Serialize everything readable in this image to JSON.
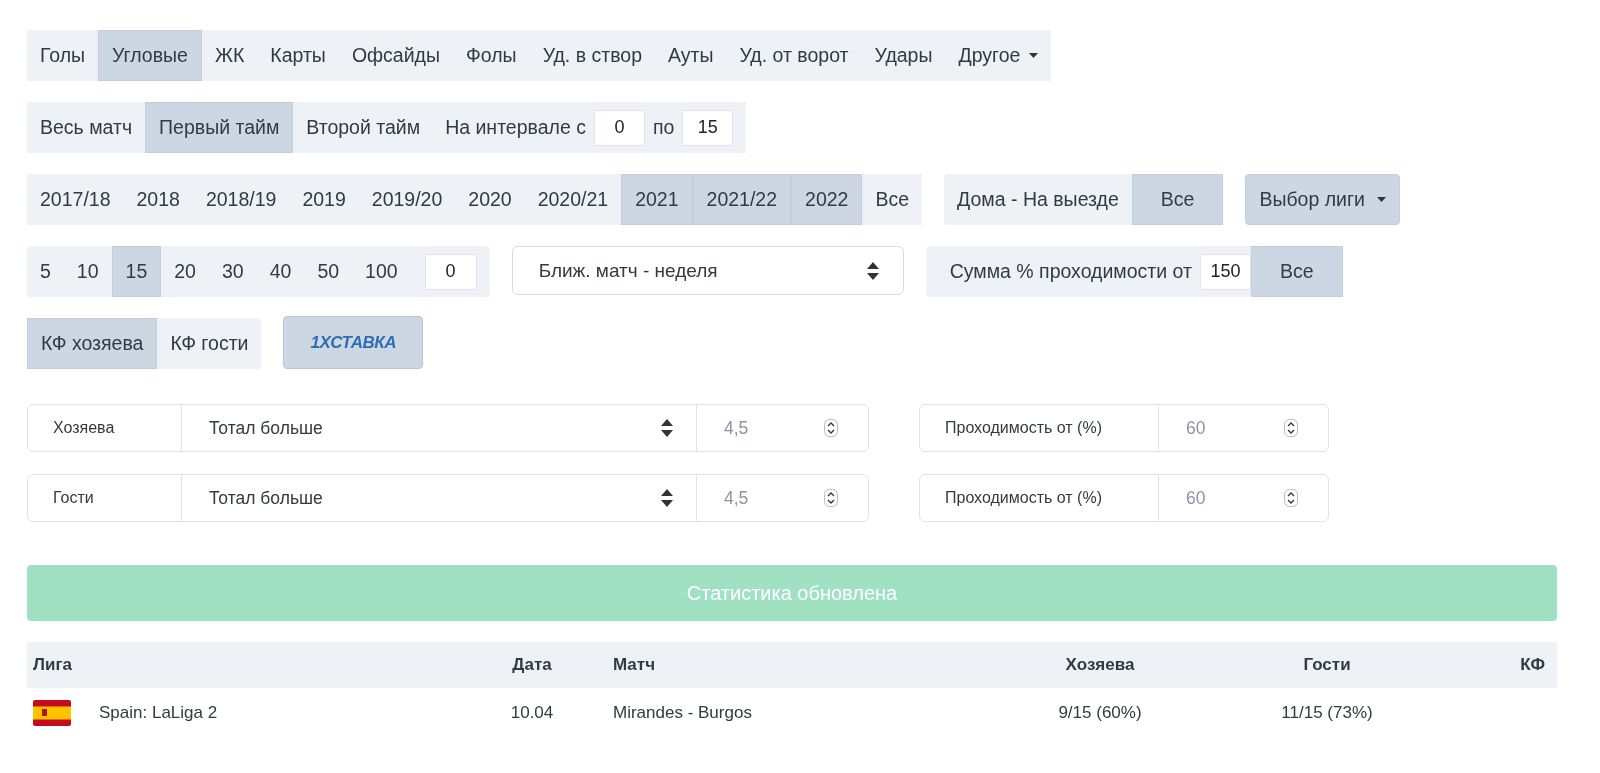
{
  "stat_tabs": [
    {
      "label": "Голы",
      "selected": false
    },
    {
      "label": "Угловые",
      "selected": true
    },
    {
      "label": "ЖК",
      "selected": false
    },
    {
      "label": "Карты",
      "selected": false
    },
    {
      "label": "Офсайды",
      "selected": false
    },
    {
      "label": "Фолы",
      "selected": false
    },
    {
      "label": "Уд. в створ",
      "selected": false
    },
    {
      "label": "Ауты",
      "selected": false
    },
    {
      "label": "Уд. от ворот",
      "selected": false
    },
    {
      "label": "Удары",
      "selected": false
    },
    {
      "label": "Другое",
      "selected": false,
      "kind": "dropdown"
    }
  ],
  "period": {
    "tabs": [
      {
        "label": "Весь матч",
        "selected": false
      },
      {
        "label": "Первый тайм",
        "selected": true
      },
      {
        "label": "Второй тайм",
        "selected": false
      }
    ],
    "interval_label": "На интервале с",
    "from": "0",
    "to_label": "по",
    "to": "15"
  },
  "seasons": [
    {
      "label": "2017/18",
      "selected": false
    },
    {
      "label": "2018",
      "selected": false
    },
    {
      "label": "2018/19",
      "selected": false
    },
    {
      "label": "2019",
      "selected": false
    },
    {
      "label": "2019/20",
      "selected": false
    },
    {
      "label": "2020",
      "selected": false
    },
    {
      "label": "2020/21",
      "selected": false
    },
    {
      "label": "2021",
      "selected": true
    },
    {
      "label": "2021/22",
      "selected": true
    },
    {
      "label": "2022",
      "selected": true
    },
    {
      "label": "Все",
      "selected": false
    }
  ],
  "venue": [
    {
      "label": "Дома - На выезде",
      "selected": false
    },
    {
      "label": "Все",
      "selected": true
    }
  ],
  "league_button": {
    "label": "Выбор лиги"
  },
  "match_counts": {
    "items": [
      {
        "label": "5",
        "selected": false
      },
      {
        "label": "10",
        "selected": false
      },
      {
        "label": "15",
        "selected": true
      },
      {
        "label": "20",
        "selected": false
      },
      {
        "label": "30",
        "selected": false
      },
      {
        "label": "40",
        "selected": false
      },
      {
        "label": "50",
        "selected": false
      },
      {
        "label": "100",
        "selected": false
      }
    ],
    "custom": "0"
  },
  "nearest_select": {
    "value": "Ближ. матч - неделя"
  },
  "sum_filter": {
    "label": "Сумма % проходимости от",
    "value": "150",
    "button": "Все"
  },
  "odds_tabs": [
    {
      "label": "КФ хозяева",
      "selected": true
    },
    {
      "label": "КФ гости",
      "selected": false
    }
  ],
  "bookmaker_button": {
    "label": "1XСТАВКА"
  },
  "market_rows": [
    {
      "team": "Хозяева",
      "market": "Тотал больше",
      "line_placeholder": "4,5",
      "pass_label": "Проходимость от (%)",
      "pass_placeholder": "60"
    },
    {
      "team": "Гости",
      "market": "Тотал больше",
      "line_placeholder": "4,5",
      "pass_label": "Проходимость от (%)",
      "pass_placeholder": "60"
    }
  ],
  "status_banner": "Статистика обновлена",
  "table": {
    "columns": [
      "Лига",
      "Дата",
      "Матч",
      "Хозяева",
      "Гости",
      "КФ"
    ],
    "rows": [
      {
        "league": "Spain: LaLiga 2",
        "date": "10.04",
        "match": "Mirandes - Burgos",
        "home": "9/15 (60%)",
        "away": "11/15 (73%)"
      }
    ]
  }
}
